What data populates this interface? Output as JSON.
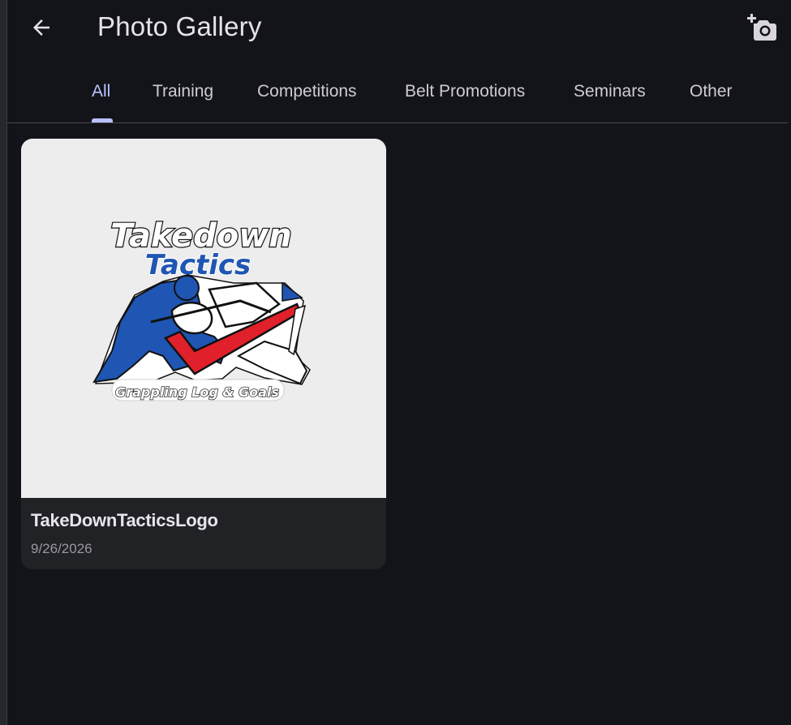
{
  "header": {
    "title": "Photo Gallery",
    "back_icon": "arrow-left-icon",
    "add_icon": "add-photo-camera-icon"
  },
  "tabs": [
    {
      "label": "All",
      "active": true
    },
    {
      "label": "Training",
      "active": false
    },
    {
      "label": "Competitions",
      "active": false
    },
    {
      "label": "Belt Promotions",
      "active": false
    },
    {
      "label": "Seminars",
      "active": false
    },
    {
      "label": "Other",
      "active": false
    }
  ],
  "photos": [
    {
      "title": "TakeDownTacticsLogo",
      "date": "9/26/2026",
      "logo": {
        "line1": "Takedown",
        "line2": "Tactics",
        "tagline": "Grappling Log & Goals"
      }
    }
  ],
  "colors": {
    "background": "#131419",
    "accent": "#b9c1ff",
    "card": "#212226",
    "logo_blue": "#1f55b3",
    "logo_red": "#e0202a"
  }
}
